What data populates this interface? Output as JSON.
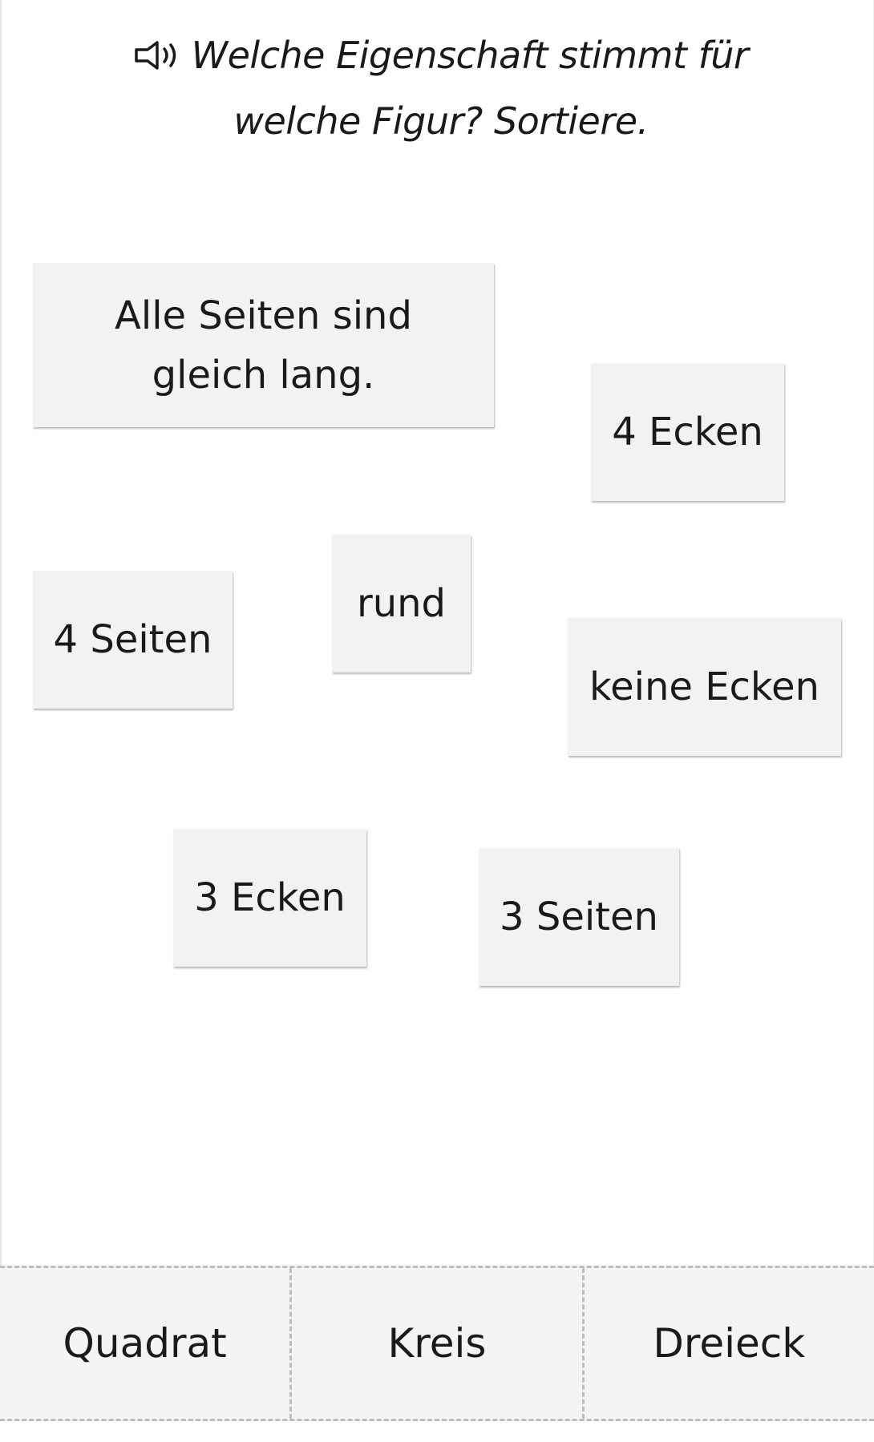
{
  "prompt": {
    "text": "Welche Eigenschaft stimmt für welche Figur? Sortiere.",
    "audio_icon": "speaker-icon"
  },
  "cards": [
    {
      "id": "alle-seiten",
      "label": "Alle Seiten sind gleich lang."
    },
    {
      "id": "4-ecken",
      "label": "4 Ecken"
    },
    {
      "id": "rund",
      "label": "rund"
    },
    {
      "id": "4-seiten",
      "label": "4 Seiten"
    },
    {
      "id": "keine-ecken",
      "label": "keine Ecken"
    },
    {
      "id": "3-ecken",
      "label": "3 Ecken"
    },
    {
      "id": "3-seiten",
      "label": "3 Seiten"
    }
  ],
  "categories": [
    {
      "id": "quadrat",
      "label": "Quadrat"
    },
    {
      "id": "kreis",
      "label": "Kreis"
    },
    {
      "id": "dreieck",
      "label": "Dreieck"
    }
  ],
  "colors": {
    "card_bg": "#f2f2f2",
    "dropzone_bg": "#f4f4f4",
    "dash": "#bdbdbd",
    "text": "#1a1a1a"
  }
}
